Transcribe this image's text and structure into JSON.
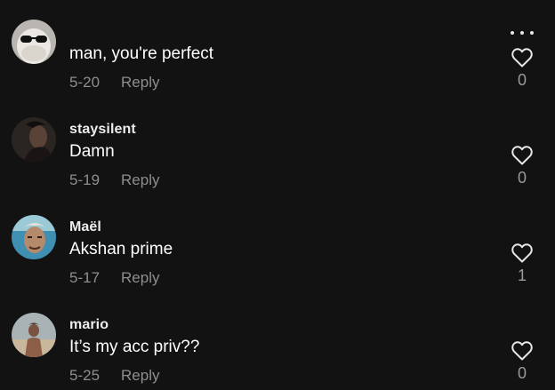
{
  "comments": [
    {
      "username": "",
      "text": "man, you're perfect",
      "date": "5-20",
      "reply_label": "Reply",
      "likes": "0",
      "avatar_icon": "sunglasses-avatar-icon"
    },
    {
      "username": "staysilent",
      "text": "Damn",
      "date": "5-19",
      "reply_label": "Reply",
      "likes": "0",
      "avatar_icon": "dark-portrait-avatar-icon"
    },
    {
      "username": "Maël",
      "text": "Akshan prime",
      "date": "5-17",
      "reply_label": "Reply",
      "likes": "1",
      "avatar_icon": "illustrated-face-avatar-icon"
    },
    {
      "username": "mario",
      "text": "It’s my acc priv??",
      "date": "5-25",
      "reply_label": "Reply",
      "likes": "0",
      "avatar_icon": "beach-portrait-avatar-icon"
    }
  ],
  "colors": {
    "background": "#121212",
    "primary_text": "#ffffff",
    "secondary_text": "#8e8e8e"
  }
}
